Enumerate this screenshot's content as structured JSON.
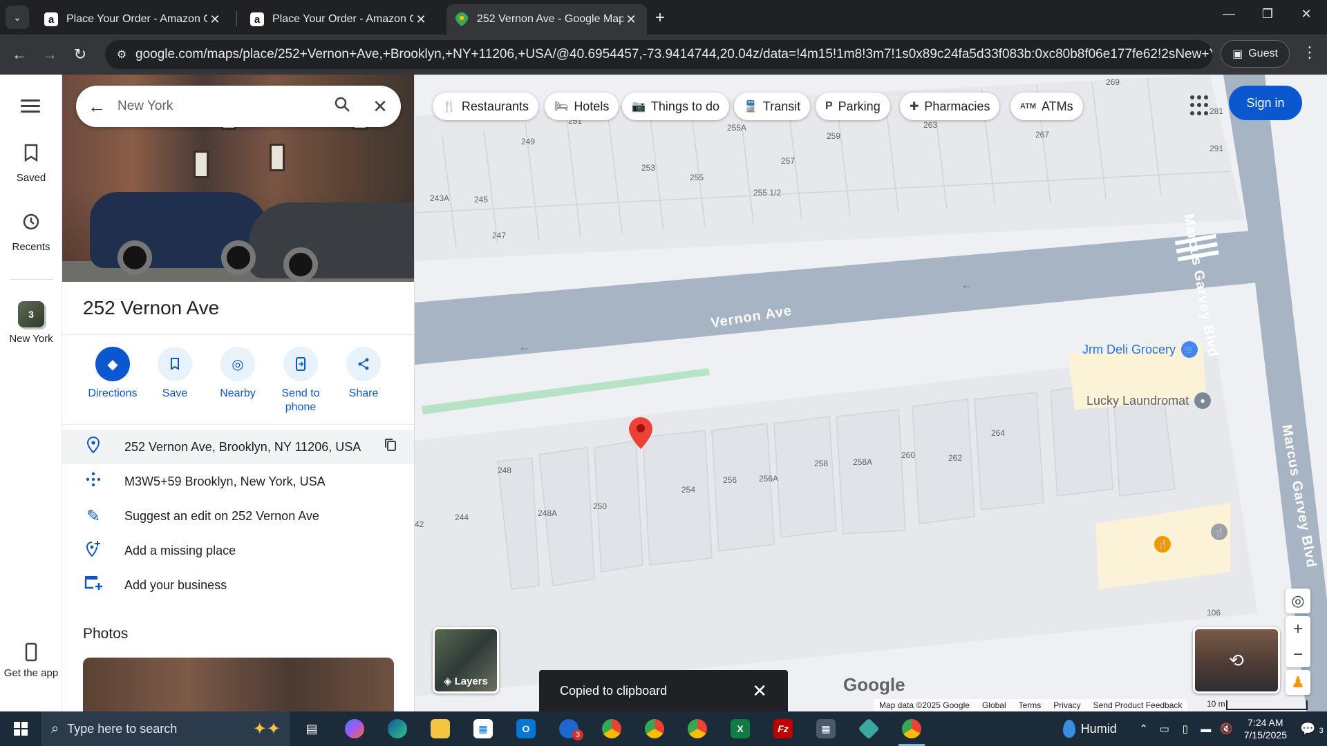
{
  "browser": {
    "tabs": [
      {
        "title": "Place Your Order - Amazon Checkout",
        "favicon": "a",
        "active": false
      },
      {
        "title": "Place Your Order - Amazon Checkout",
        "favicon": "a",
        "active": false
      },
      {
        "title": "252 Vernon Ave - Google Maps",
        "favicon": "maps-pin",
        "active": true
      }
    ],
    "url": "google.com/maps/place/252+Vernon+Ave,+Brooklyn,+NY+11206,+USA/@40.6954457,-73.9414744,20.04z/data=!4m15!1m8!3m7!1s0x89c24fa5d33f083b:0xc80b8f06e177fe62!2sNew+York,+NY,+U...",
    "profile_label": "Guest"
  },
  "rail": {
    "saved_label": "Saved",
    "recents_label": "Recents",
    "recent_place_label": "New York",
    "recent_place_count": "3",
    "get_app_label": "Get the app"
  },
  "search": {
    "value": "New York"
  },
  "place": {
    "title": "252 Vernon Ave",
    "actions": [
      {
        "label": "Directions",
        "icon": "directions-icon"
      },
      {
        "label": "Save",
        "icon": "bookmark-icon"
      },
      {
        "label": "Nearby",
        "icon": "nearby-icon"
      },
      {
        "label": "Send to phone",
        "icon": "send-to-phone-icon"
      },
      {
        "label": "Share",
        "icon": "share-icon"
      }
    ],
    "address": "252 Vernon Ave, Brooklyn, NY 11206, USA",
    "plus_code": "M3W5+59 Brooklyn, New York, USA",
    "suggest_edit": "Suggest an edit on 252 Vernon Ave",
    "add_missing_place": "Add a missing place",
    "add_business": "Add your business",
    "photos_title": "Photos"
  },
  "map": {
    "chips": [
      "Restaurants",
      "Hotels",
      "Things to do",
      "Transit",
      "Parking",
      "Pharmacies",
      "ATMs"
    ],
    "sign_in_label": "Sign in",
    "layers_label": "Layers",
    "road_vernon": "Vernon Ave",
    "road_marcus_1": "Marcus Garvey Blvd",
    "road_marcus_2": "Marcus Garvey Blvd",
    "poi_deli": "Jrm Deli Grocery",
    "poi_laundromat": "Lucky Laundromat",
    "house_numbers": {
      "n269": "269",
      "n281": "281",
      "n291": "291",
      "n251": "251",
      "n249": "249",
      "n255a": "255A",
      "n259": "259",
      "n263": "263",
      "n267": "267",
      "n257": "257",
      "n253": "253",
      "n255": "255",
      "n255h": "255 1/2",
      "n243a": "243A",
      "n245": "245",
      "n247": "247",
      "n248": "248",
      "n244": "244",
      "n248a": "248A",
      "n250": "250",
      "n254": "254",
      "n256": "256",
      "n256a": "256A",
      "n258": "258",
      "n258a": "258A",
      "n260": "260",
      "n262": "262",
      "n264": "264",
      "n42": "42",
      "n106": "106"
    },
    "google_logo": "Google",
    "footer": {
      "map_data": "Map data ©2025 Google",
      "global": "Global",
      "terms": "Terms",
      "privacy": "Privacy",
      "feedback": "Send Product Feedback",
      "scale": "10 m"
    },
    "toast": "Copied to clipboard"
  },
  "taskbar": {
    "search_placeholder": "Type here to search",
    "weather": "Humid",
    "time": "7:24 AM",
    "date": "7/15/2025",
    "notifications": "3",
    "outlook_badge": "3"
  },
  "colors": {
    "accent": "#0b57d0",
    "pin": "#ea4335",
    "road": "#a7b4c3"
  }
}
